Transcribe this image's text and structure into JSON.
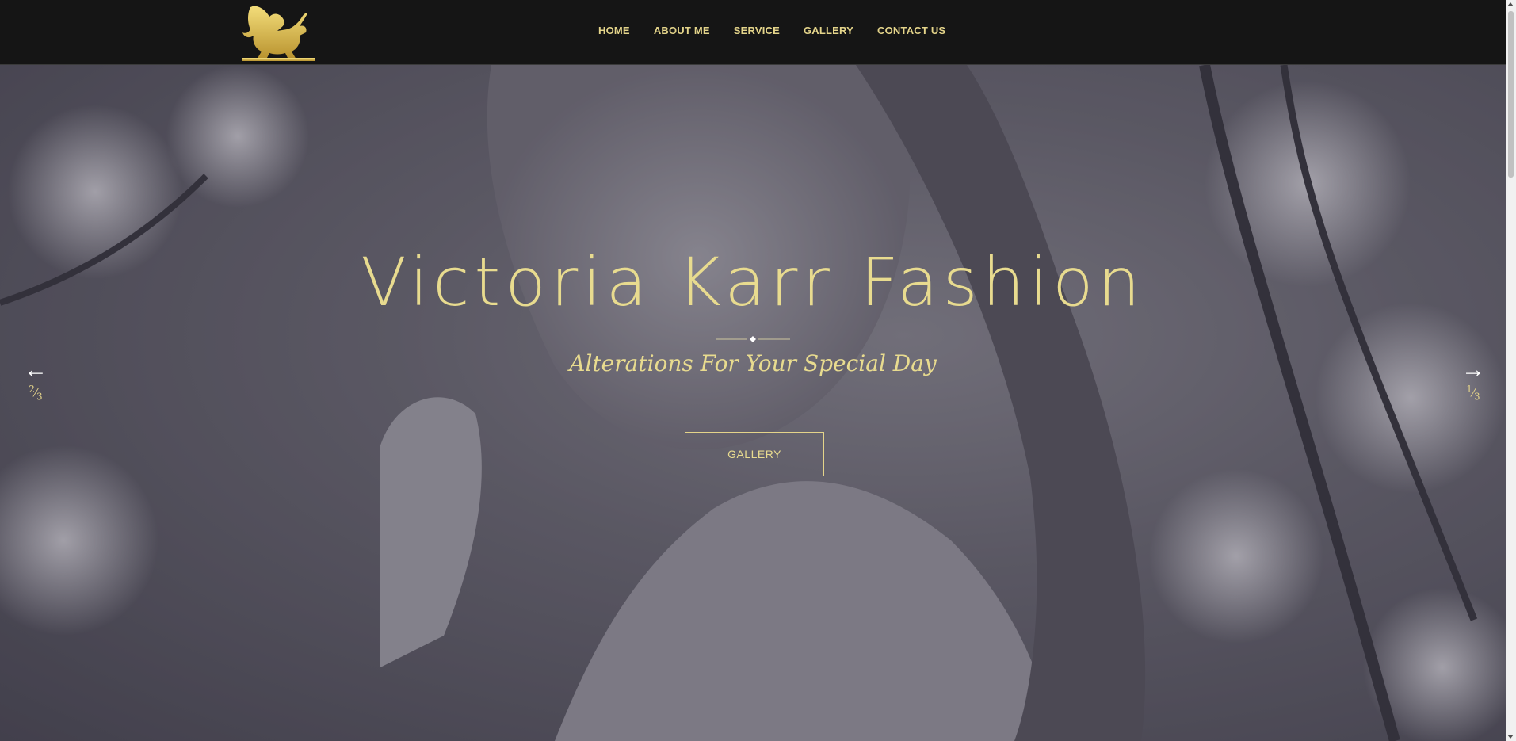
{
  "header": {
    "logo_icon": "winged-griffin-logo-icon",
    "nav": [
      "HOME",
      "ABOUT ME",
      "SERVICE",
      "GALLERY",
      "CONTACT US"
    ]
  },
  "hero": {
    "title": "Victoria Karr Fashion",
    "subtitle": "Alterations For Your Special Day",
    "button_label": "GALLERY",
    "prev": {
      "icon": "arrow-left-icon",
      "glyph": "←",
      "current": "2",
      "total": "3"
    },
    "next": {
      "icon": "arrow-right-icon",
      "glyph": "→",
      "current": "1",
      "total": "3"
    }
  },
  "colors": {
    "accent": "#e4d48a",
    "nav_bg": "#151515",
    "arrow": "#ffffff"
  }
}
